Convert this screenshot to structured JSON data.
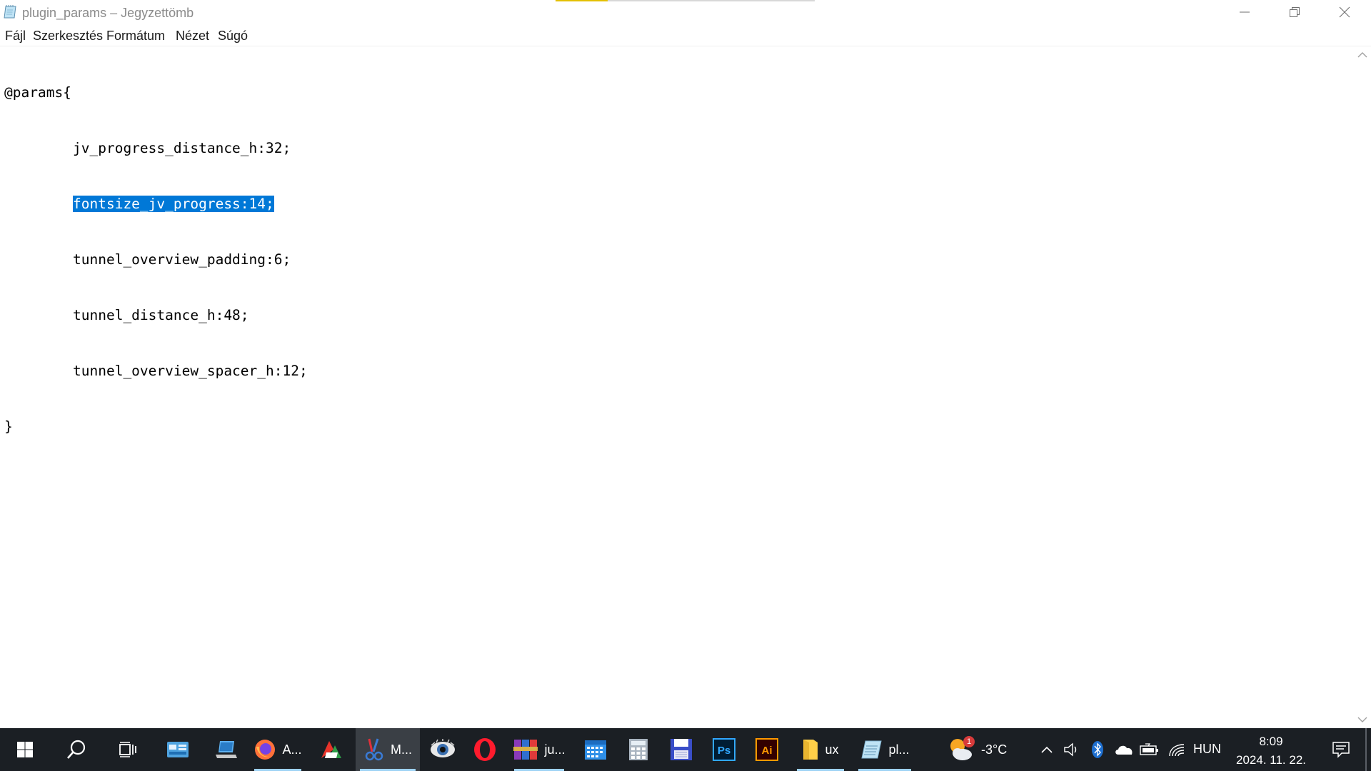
{
  "window": {
    "title": "plugin_params – Jegyzettömb",
    "minimize": "minimize",
    "maximize": "restore",
    "close": "close"
  },
  "menu": [
    "Fájl",
    "Szerkesztés",
    "Formátum",
    "Nézet",
    "Súgó"
  ],
  "editor": {
    "line1": "@params{",
    "line2": "jv_progress_distance_h:32;",
    "line3": "fontsize_jv_progress:14;",
    "line4": "tunnel_overview_padding:6;",
    "line5": "tunnel_distance_h:48;",
    "line6": "tunnel_overview_spacer_h:12;",
    "line7": "}"
  },
  "taskbar": {
    "apps": [
      {
        "name": "firefox",
        "label": "A..."
      },
      {
        "name": "app-m",
        "label": "M..."
      },
      {
        "name": "winrar",
        "label": "ju..."
      },
      {
        "name": "explorer",
        "label": "ux"
      },
      {
        "name": "notepad",
        "label": "pl..."
      }
    ],
    "weather": {
      "temp": "-3°C",
      "badge": "1"
    },
    "language": "HUN",
    "time": "8:09",
    "date": "2024. 11. 22."
  },
  "colors": {
    "selection": "#0078d7",
    "taskbar": "#1b1f24",
    "active_taskbar": "#3a3f45",
    "accent_underline": "#9fd3f5"
  }
}
